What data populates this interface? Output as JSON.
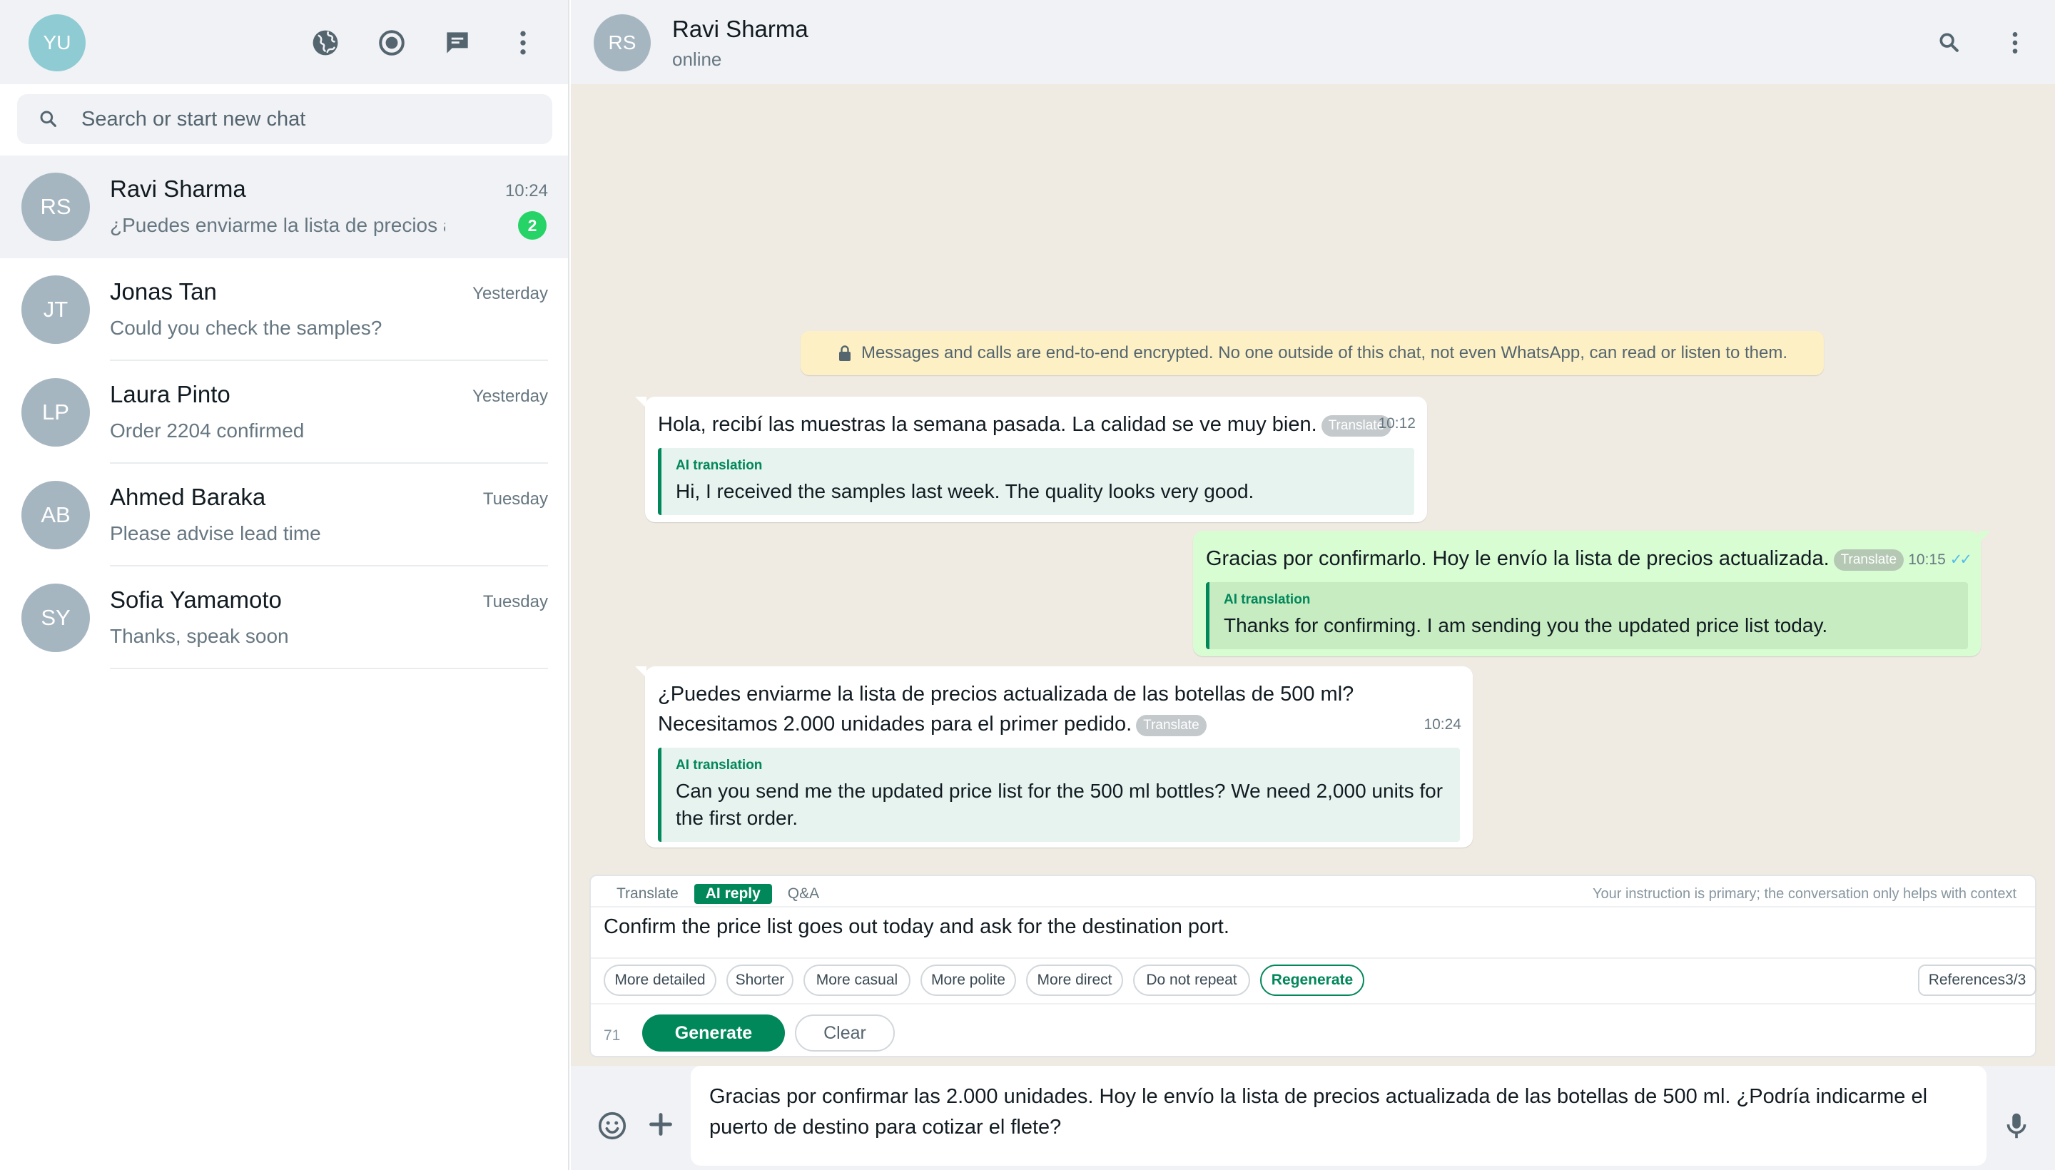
{
  "sidebar": {
    "me_initials": "YU",
    "search": {
      "placeholder": "Search or start new chat",
      "value": ""
    },
    "header_icons": [
      "communities-icon",
      "status-icon",
      "new-chat-icon",
      "menu-icon"
    ],
    "chats": [
      {
        "initials": "RS",
        "name": "Ravi Sharma",
        "preview": "¿Puedes enviarme la lista de precios a",
        "time": "10:24",
        "unread": "2",
        "active": true
      },
      {
        "initials": "JT",
        "name": "Jonas Tan",
        "preview": "Could you check the samples?",
        "time": "Yesterday"
      },
      {
        "initials": "LP",
        "name": "Laura Pinto",
        "preview": "Order 2204 confirmed",
        "time": "Yesterday"
      },
      {
        "initials": "AB",
        "name": "Ahmed Baraka",
        "preview": "Please advise lead time",
        "time": "Tuesday"
      },
      {
        "initials": "SY",
        "name": "Sofia Yamamoto",
        "preview": "Thanks, speak soon",
        "time": "Tuesday"
      }
    ]
  },
  "header": {
    "initials": "RS",
    "name": "Ravi Sharma",
    "status": "online"
  },
  "encryption_notice": "Messages and calls are end-to-end encrypted. No one outside of this chat, not even WhatsApp, can read or listen to them.",
  "messages": [
    {
      "direction": "in",
      "text": "Hola, recibí las muestras la semana pasada. La calidad se ve muy bien.",
      "translate_label": "Translate",
      "time": "10:12",
      "ai_label": "AI translation",
      "translation": "Hi, I received the samples last week. The quality looks very good."
    },
    {
      "direction": "out",
      "text": "Gracias por confirmarlo. Hoy le envío la lista de precios actualizada.",
      "translate_label": "Translate",
      "time": "10:15",
      "ticks": "✓✓",
      "ai_label": "AI translation",
      "translation": "Thanks for confirming. I am sending you the updated price list today."
    },
    {
      "direction": "in",
      "text": "¿Puedes enviarme la lista de precios actualizada de las botellas de 500 ml? Necesitamos 2.000 unidades para el primer pedido.",
      "translate_label": "Translate",
      "time": "10:24",
      "ai_label": "AI translation",
      "translation": "Can you send me the updated price list for the 500 ml bottles? We need 2,000 units for the first order."
    }
  ],
  "ai_panel": {
    "tabs": [
      {
        "label": "Translate",
        "active": false
      },
      {
        "label": "AI reply",
        "active": true
      },
      {
        "label": "Q&A",
        "active": false
      }
    ],
    "hint": "Your instruction is primary; the conversation only helps with context",
    "instruction": "Confirm the price list goes out today and ask for the destination port.",
    "chips": [
      "More detailed",
      "Shorter",
      "More casual",
      "More polite",
      "More direct",
      "Do not repeat",
      "Regenerate"
    ],
    "references": "References3/3",
    "char_count": "71",
    "generate_label": "Generate",
    "clear_label": "Clear"
  },
  "composer": {
    "draft": "Gracias por confirmar las 2.000 unidades. Hoy le envío la lista de precios actualizada de las botellas de 500 ml. ¿Podría indicarme el puerto de destino para cotizar el flete?",
    "icons": [
      "emoji-icon",
      "attach-plus-icon",
      "microphone-icon"
    ]
  },
  "colors": {
    "accent": "#00875a",
    "unread_badge": "#25d366",
    "outgoing_bubble": "#d9fdd3",
    "chat_background": "#efeae2",
    "encryption_notice": "#fdf0c4",
    "read_ticks": "#53bdeb"
  }
}
